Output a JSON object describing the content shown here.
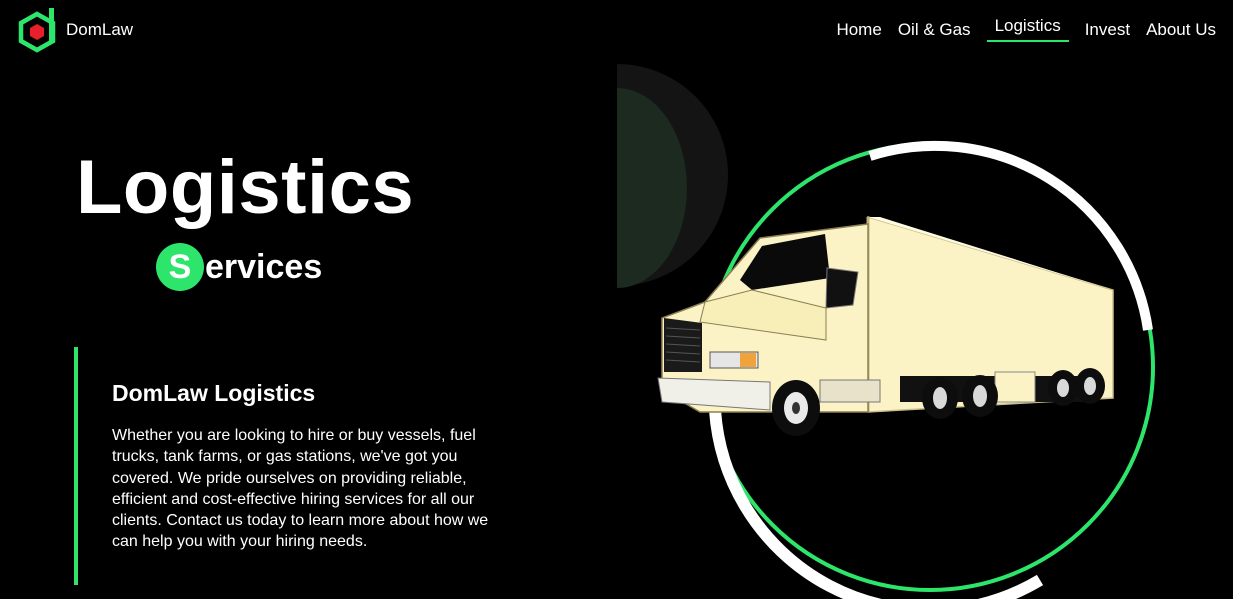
{
  "header": {
    "brand": "DomLaw",
    "nav": [
      {
        "label": "Home",
        "active": false
      },
      {
        "label": "Oil & Gas",
        "active": false
      },
      {
        "label": "Logistics",
        "active": true
      },
      {
        "label": "Invest",
        "active": false
      },
      {
        "label": "About Us",
        "active": false
      }
    ]
  },
  "hero": {
    "title": "Logistics",
    "subtitle_initial": "S",
    "subtitle_rest": "ervices"
  },
  "info": {
    "heading": "DomLaw Logistics",
    "body": "Whether you are looking to hire or buy vessels, fuel trucks, tank farms, or gas stations, we've got you covered. We pride ourselves on providing reliable, efficient and cost-effective hiring services for all our clients. Contact us today to learn more about how we can help you with your hiring needs."
  },
  "colors": {
    "accent": "#2ee56c",
    "background": "#000000",
    "truck_body": "#fbf3c5",
    "logo_red": "#e8202a"
  },
  "icons": {
    "logo": "domlaw-logo-icon",
    "hero_image": "truck-image"
  }
}
